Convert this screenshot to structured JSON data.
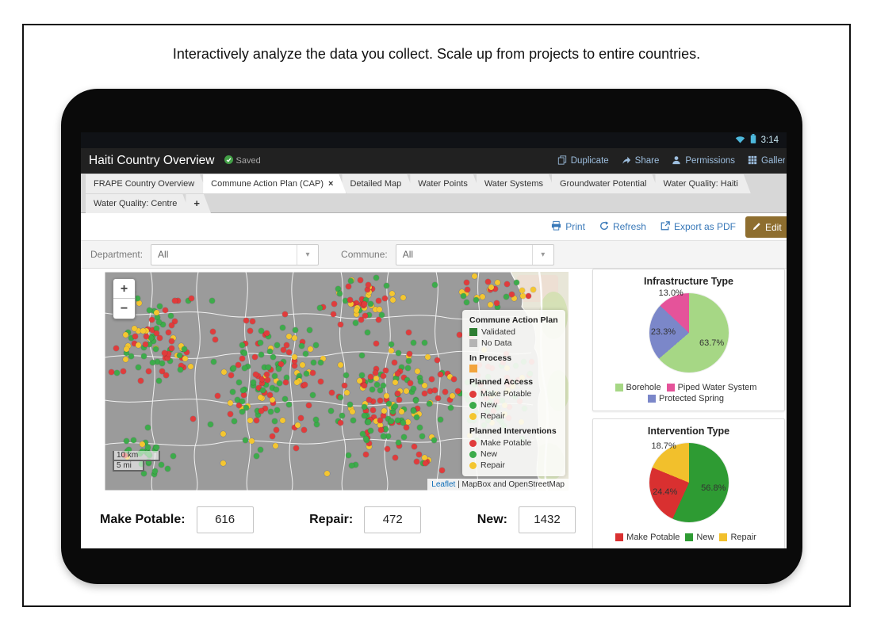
{
  "caption": "Interactively analyze the data you collect. Scale up from projects to entire countries.",
  "status_bar": {
    "time": "3:14"
  },
  "header": {
    "title": "Haiti Country Overview",
    "saved_label": "Saved",
    "actions": [
      {
        "label": "Duplicate",
        "icon": "duplicate-icon"
      },
      {
        "label": "Share",
        "icon": "share-icon"
      },
      {
        "label": "Permissions",
        "icon": "person-icon"
      },
      {
        "label": "Gallery",
        "icon": "grid-icon"
      }
    ]
  },
  "tabs": {
    "row1": [
      "FRAPE Country Overview",
      "Commune Action Plan (CAP)",
      "Detailed Map",
      "Water Points",
      "Water Systems",
      "Groundwater Potential",
      "Water Quality: Haiti"
    ],
    "row2": [
      "Water Quality: Centre"
    ],
    "active": "Commune Action Plan (CAP)",
    "close_glyph": "×",
    "add_label": "+"
  },
  "toolbar": {
    "print_label": "Print",
    "refresh_label": "Refresh",
    "export_label": "Export as PDF",
    "edit_label": "Edit"
  },
  "filters": {
    "department_label": "Department:",
    "department_value": "All",
    "commune_label": "Commune:",
    "commune_value": "All"
  },
  "map": {
    "zoom_in": "+",
    "zoom_out": "−",
    "scale_km": "10 km",
    "scale_mi": "5 mi",
    "attribution": {
      "leaflet": "Leaflet",
      "separator": " | ",
      "rest": "MapBox and OpenStreetMap"
    },
    "marker_colors": {
      "new": "#3dab4b",
      "make_potable": "#e03c3c",
      "repair": "#f4c630"
    },
    "legend": {
      "sections": [
        {
          "title": "Commune Action Plan",
          "items": [
            {
              "label": "Validated",
              "color": "#2e7d32",
              "shape": "square"
            },
            {
              "label": "No Data",
              "color": "#b4b4b4",
              "shape": "square"
            }
          ]
        },
        {
          "title": "In Process",
          "items": [
            {
              "label": "",
              "color": "#f2a33c",
              "shape": "square"
            }
          ]
        },
        {
          "title": "Planned Access",
          "items": [
            {
              "label": "Make Potable",
              "color": "#e03c3c",
              "shape": "circle"
            },
            {
              "label": "New",
              "color": "#3dab4b",
              "shape": "circle"
            },
            {
              "label": "Repair",
              "color": "#f4c630",
              "shape": "circle"
            }
          ]
        },
        {
          "title": "Planned Interventions",
          "items": [
            {
              "label": "Make Potable",
              "color": "#e03c3c",
              "shape": "circle"
            },
            {
              "label": "New",
              "color": "#3dab4b",
              "shape": "circle"
            },
            {
              "label": "Repair",
              "color": "#f4c630",
              "shape": "circle"
            }
          ]
        }
      ]
    }
  },
  "chart_data": [
    {
      "type": "pie",
      "title": "Infrastructure Type",
      "slices": [
        {
          "label": "Borehole",
          "value": 63.7,
          "display": "63.7%",
          "color": "#a6d785"
        },
        {
          "label": "Protected Spring",
          "value": 23.3,
          "display": "23.3%",
          "color": "#7b87c9"
        },
        {
          "label": "Piped Water System",
          "value": 13.0,
          "display": "13.0%",
          "color": "#e5539a"
        }
      ],
      "legend_order": [
        "Borehole",
        "Piped Water System",
        "Protected Spring"
      ],
      "legend_position": "bottom"
    },
    {
      "type": "pie",
      "title": "Intervention Type",
      "slices": [
        {
          "label": "New",
          "value": 56.8,
          "display": "56.8%",
          "color": "#2e9b33"
        },
        {
          "label": "Make Potable",
          "value": 24.4,
          "display": "24.4%",
          "color": "#d93030"
        },
        {
          "label": "Repair",
          "value": 18.7,
          "display": "18.7%",
          "color": "#f2c02c"
        }
      ],
      "legend_order": [
        "Make Potable",
        "New",
        "Repair"
      ],
      "legend_position": "bottom"
    }
  ],
  "stats": [
    {
      "label": "Make Potable:",
      "value": "616"
    },
    {
      "label": "Repair:",
      "value": "472"
    },
    {
      "label": "New:",
      "value": "1432"
    }
  ]
}
